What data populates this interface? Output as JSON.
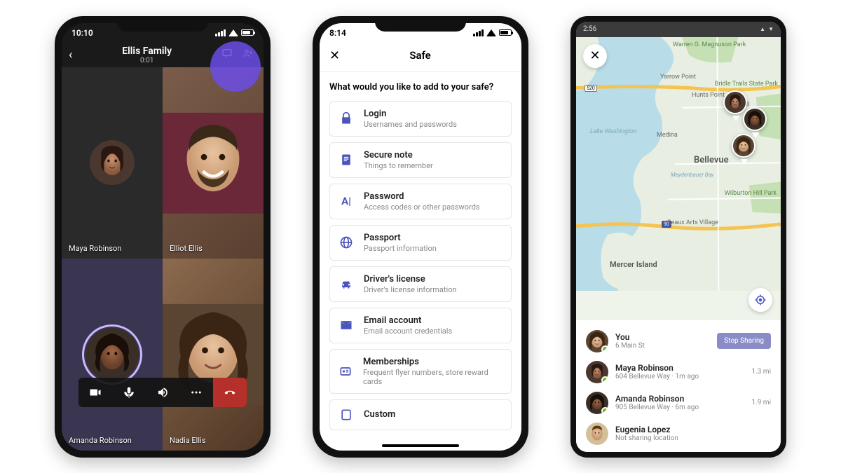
{
  "phone1": {
    "status_time": "10:10",
    "call_title": "Ellis Family",
    "call_duration": "0:01",
    "participants": [
      {
        "name": "Maya Robinson"
      },
      {
        "name": "Elliot Ellis"
      },
      {
        "name": "Amanda Robinson"
      },
      {
        "name": "Nadia Ellis"
      }
    ]
  },
  "phone2": {
    "status_time": "8:14",
    "header_title": "Safe",
    "prompt": "What would you like to add to your safe?",
    "items": [
      {
        "icon": "lock-icon",
        "title": "Login",
        "subtitle": "Usernames and passwords"
      },
      {
        "icon": "note-icon",
        "title": "Secure note",
        "subtitle": "Things to remember"
      },
      {
        "icon": "password-icon",
        "title": "Password",
        "subtitle": "Access codes or other passwords"
      },
      {
        "icon": "passport-icon",
        "title": "Passport",
        "subtitle": "Passport information"
      },
      {
        "icon": "car-icon",
        "title": "Driver's license",
        "subtitle": "Driver's license information"
      },
      {
        "icon": "mail-icon",
        "title": "Email account",
        "subtitle": "Email account credentials"
      },
      {
        "icon": "membership-icon",
        "title": "Memberships",
        "subtitle": "Frequent flyer numbers, store reward cards"
      },
      {
        "icon": "custom-icon",
        "title": "Custom",
        "subtitle": ""
      }
    ]
  },
  "phone3": {
    "status_time": "2:56",
    "stop_label": "Stop Sharing",
    "map_labels": {
      "warren_park": "Warren G. Magnuson Park",
      "yarrow": "Yarrow Point",
      "hunts": "Hunts Point",
      "clyde": "Clyde Hill",
      "bridle": "Bridle Trails State Park",
      "medina": "Medina",
      "lake": "Lake Washington",
      "bellevue": "Bellevue",
      "meydenbauer": "Meydenbauer Bay",
      "wilburton": "Wilburton Hill Park",
      "beaux": "Beaux Arts Village",
      "mercer": "Mercer Island",
      "route520": "520",
      "route90": "90"
    },
    "people": [
      {
        "name": "You",
        "sub": "6 Main St",
        "dist": "",
        "sharing": true
      },
      {
        "name": "Maya Robinson",
        "sub": "604 Bellevue Way · 1m ago",
        "dist": "1.3 mi",
        "sharing": true
      },
      {
        "name": "Amanda Robinson",
        "sub": "905 Bellevue Way · 6m ago",
        "dist": "1.9 mi",
        "sharing": true
      },
      {
        "name": "Eugenia Lopez",
        "sub": "Not sharing location",
        "dist": "",
        "sharing": false
      }
    ]
  },
  "colors": {
    "accent": "#4b53bc",
    "fab": "#6b4de6",
    "endcall": "#b5302b",
    "stop": "#8b8cc7"
  }
}
